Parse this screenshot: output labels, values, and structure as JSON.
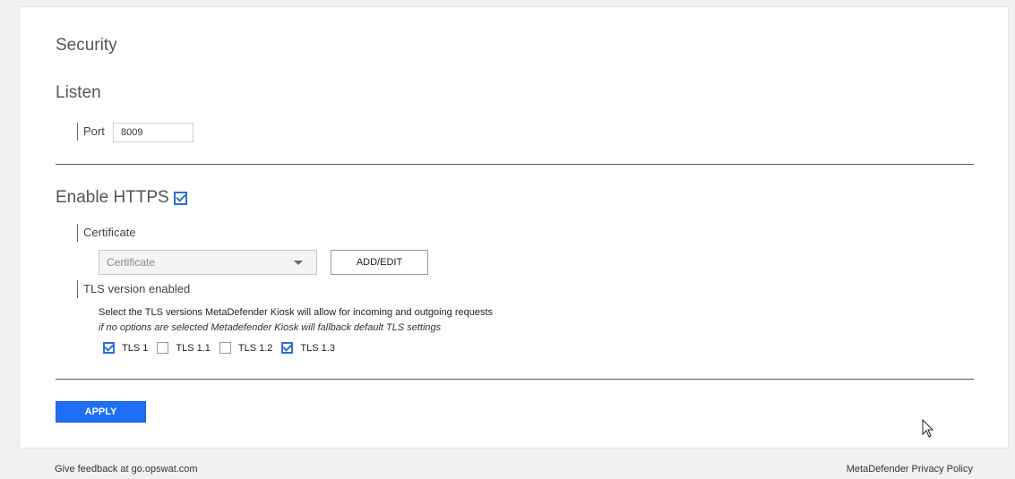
{
  "security": {
    "title": "Security"
  },
  "listen": {
    "title": "Listen",
    "port_label": "Port",
    "port_value": "8009"
  },
  "https": {
    "title": "Enable HTTPS",
    "enabled": true,
    "certificate_label": "Certificate",
    "certificate_placeholder": "Certificate",
    "add_edit_label": "ADD/EDIT",
    "tls_label": "TLS version enabled",
    "tls_description": "Select the TLS versions MetaDefender Kiosk will allow for incoming and outgoing requests",
    "tls_note": "if no options are selected Metadefender Kiosk will fallback default TLS settings",
    "tls_options": [
      {
        "label": "TLS 1",
        "checked": true
      },
      {
        "label": "TLS 1.1",
        "checked": false
      },
      {
        "label": "TLS 1.2",
        "checked": false
      },
      {
        "label": "TLS 1.3",
        "checked": true
      }
    ]
  },
  "apply_label": "APPLY",
  "footer": {
    "feedback": "Give feedback at go.opswat.com",
    "privacy": "MetaDefender Privacy Policy"
  },
  "colors": {
    "accent": "#1e6ff5",
    "checkbox": "#2e6ed6"
  },
  "icons": {
    "https_checkbox": "checkbox-checked-icon",
    "select_caret": "caret-down-icon",
    "cursor": "mouse-pointer-icon"
  }
}
